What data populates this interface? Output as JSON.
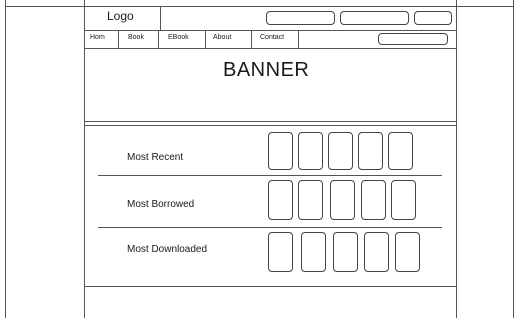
{
  "header": {
    "logo": "Logo"
  },
  "nav": {
    "items": [
      "Hom",
      "Book",
      "EBook",
      "About",
      "Contact"
    ]
  },
  "banner": {
    "text": "BANNER"
  },
  "sections": [
    {
      "label": "Most Recent"
    },
    {
      "label": "Most Borrowed"
    },
    {
      "label": "Most Downloaded"
    }
  ]
}
